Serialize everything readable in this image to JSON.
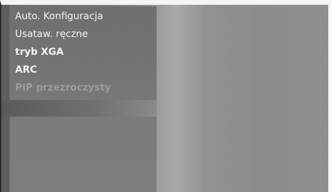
{
  "menu": {
    "items": [
      {
        "label": "Auto. Konfiguracja",
        "enabled": true
      },
      {
        "label": "Usataw. ręczne",
        "enabled": true
      },
      {
        "label": "tryb XGA",
        "enabled": true
      },
      {
        "label": "ARC",
        "enabled": true
      },
      {
        "label": "PIP przezroczysty",
        "enabled": false
      }
    ]
  }
}
